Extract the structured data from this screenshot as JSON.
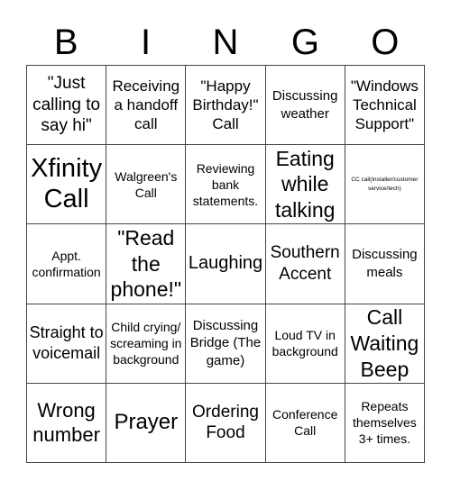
{
  "header": {
    "letters": [
      "B",
      "I",
      "N",
      "G",
      "O"
    ]
  },
  "board": {
    "cells": [
      {
        "text": "\"Just calling to say hi\"",
        "size": "s19"
      },
      {
        "text": "Receiving a handoff call",
        "size": "s17"
      },
      {
        "text": "\"Happy Birthday!\" Call",
        "size": "s17"
      },
      {
        "text": "Discussing weather",
        "size": "s15"
      },
      {
        "text": "\"Windows Technical Support\"",
        "size": "s17"
      },
      {
        "text": "Xfinity Call",
        "size": "s30"
      },
      {
        "text": "Walgreen's Call",
        "size": "s14"
      },
      {
        "text": "Reviewing bank statements.",
        "size": "s14"
      },
      {
        "text": "Eating while talking",
        "size": "s23"
      },
      {
        "text": "CC call(installer/customer service/tech)",
        "size": "s6"
      },
      {
        "text": "Appt. confirmation",
        "size": "s14"
      },
      {
        "text": "\"Read the phone!\"",
        "size": "s23"
      },
      {
        "text": "Laughing",
        "size": "s20"
      },
      {
        "text": "Southern Accent",
        "size": "s19"
      },
      {
        "text": "Discussing meals",
        "size": "s15"
      },
      {
        "text": "Straight to voicemail",
        "size": "s18"
      },
      {
        "text": "Child crying/ screaming in background",
        "size": "s14"
      },
      {
        "text": "Discussing Bridge (The game)",
        "size": "s15"
      },
      {
        "text": "Loud TV in background",
        "size": "s14"
      },
      {
        "text": "Call Waiting Beep",
        "size": "s23"
      },
      {
        "text": "Wrong number",
        "size": "s22"
      },
      {
        "text": "Prayer",
        "size": "s24"
      },
      {
        "text": "Ordering Food",
        "size": "s19"
      },
      {
        "text": "Conference Call",
        "size": "s14"
      },
      {
        "text": "Repeats themselves 3+ times.",
        "size": "s14"
      }
    ]
  }
}
